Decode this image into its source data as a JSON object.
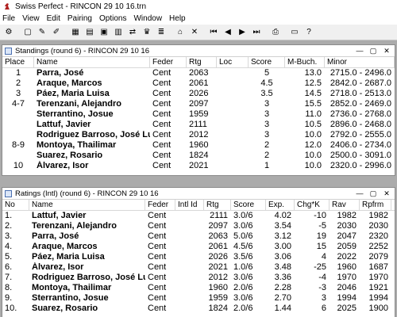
{
  "app": {
    "title": "Swiss Perfect - RINCON 29 10 16.trn"
  },
  "menu": [
    "File",
    "View",
    "Edit",
    "Pairing",
    "Options",
    "Window",
    "Help"
  ],
  "toolbar": [
    {
      "icon": "players-icon",
      "glyph": "⚙"
    },
    {
      "icon": "new-icon",
      "glyph": "▢"
    },
    {
      "icon": "pen-icon",
      "glyph": "✎"
    },
    {
      "icon": "pen-star-icon",
      "glyph": "✐"
    },
    {
      "icon": "table-icon",
      "glyph": "▦"
    },
    {
      "icon": "grid-icon",
      "glyph": "▤"
    },
    {
      "icon": "card-icon",
      "glyph": "▣"
    },
    {
      "icon": "standings-icon",
      "glyph": "▥"
    },
    {
      "icon": "shuffle-icon",
      "glyph": "⇄"
    },
    {
      "icon": "trophy-icon",
      "glyph": "♛"
    },
    {
      "icon": "list-icon",
      "glyph": "≣"
    },
    {
      "icon": "building-icon",
      "glyph": "⌂"
    },
    {
      "icon": "delete-icon",
      "glyph": "✕"
    },
    {
      "icon": "first-icon",
      "glyph": "⏮"
    },
    {
      "icon": "prev-icon",
      "glyph": "◀"
    },
    {
      "icon": "next-icon",
      "glyph": "▶"
    },
    {
      "icon": "last-icon",
      "glyph": "⏭"
    },
    {
      "icon": "print-icon",
      "glyph": "⎙"
    },
    {
      "icon": "preview-icon",
      "glyph": "▭"
    },
    {
      "icon": "help-icon",
      "glyph": "?"
    }
  ],
  "standings": {
    "title": "Standings  (round 6) - RINCON 29 10 16",
    "columns": [
      "Place",
      "Name",
      "Feder",
      "Rtg",
      "Loc",
      "Score",
      "M-Buch.",
      "Minor"
    ],
    "rows": [
      {
        "place": "1",
        "name": "Parra, José",
        "feder": "Cent",
        "rtg": "2063",
        "loc": "",
        "score": "5",
        "mbuch": "13.0",
        "minor": "2715.0 - 2496.0"
      },
      {
        "place": "2",
        "name": "Araque, Marcos",
        "feder": "Cent",
        "rtg": "2061",
        "loc": "",
        "score": "4.5",
        "mbuch": "12.5",
        "minor": "2842.0 - 2687.0"
      },
      {
        "place": "3",
        "name": "Páez, Maria Luisa",
        "feder": "Cent",
        "rtg": "2026",
        "loc": "",
        "score": "3.5",
        "mbuch": "14.5",
        "minor": "2718.0 - 2513.0"
      },
      {
        "place": "4-7",
        "name": "Terenzani, Alejandro",
        "feder": "Cent",
        "rtg": "2097",
        "loc": "",
        "score": "3",
        "mbuch": "15.5",
        "minor": "2852.0 - 2469.0"
      },
      {
        "place": "",
        "name": "Sterrantino, Josue",
        "feder": "Cent",
        "rtg": "1959",
        "loc": "",
        "score": "3",
        "mbuch": "11.0",
        "minor": "2736.0 - 2768.0"
      },
      {
        "place": "",
        "name": "Lattuf, Javier",
        "feder": "Cent",
        "rtg": "2111",
        "loc": "",
        "score": "3",
        "mbuch": "10.5",
        "minor": "2896.0 - 2468.0"
      },
      {
        "place": "",
        "name": "Rodriguez Barroso, José Luis",
        "feder": "Cent",
        "rtg": "2012",
        "loc": "",
        "score": "3",
        "mbuch": "10.0",
        "minor": "2792.0 - 2555.0"
      },
      {
        "place": "8-9",
        "name": "Montoya, Thailimar",
        "feder": "Cent",
        "rtg": "1960",
        "loc": "",
        "score": "2",
        "mbuch": "12.0",
        "minor": "2406.0 - 2734.0"
      },
      {
        "place": "",
        "name": "Suarez, Rosario",
        "feder": "Cent",
        "rtg": "1824",
        "loc": "",
        "score": "2",
        "mbuch": "10.0",
        "minor": "2500.0 - 3091.0"
      },
      {
        "place": "10",
        "name": "Álvarez, Isor",
        "feder": "Cent",
        "rtg": "2021",
        "loc": "",
        "score": "1",
        "mbuch": "10.0",
        "minor": "2320.0 - 2996.0"
      }
    ]
  },
  "ratings": {
    "title": "Ratings (Intl)  (round 6) - RINCON 29 10 16",
    "columns": [
      "No",
      "Name",
      "Feder",
      "Intl Id",
      "Rtg",
      "Score",
      "Exp.",
      "Chg*K",
      "Rav",
      "Rpfrm"
    ],
    "rows": [
      {
        "no": "1.",
        "name": "Lattuf, Javier",
        "feder": "Cent",
        "intl": "",
        "rtg": "2111",
        "score": "3.0/6",
        "exp": "4.02",
        "chg": "-10",
        "rav": "1982",
        "rpfrm": "1982"
      },
      {
        "no": "2.",
        "name": "Terenzani, Alejandro",
        "feder": "Cent",
        "intl": "",
        "rtg": "2097",
        "score": "3.0/6",
        "exp": "3.54",
        "chg": "-5",
        "rav": "2030",
        "rpfrm": "2030"
      },
      {
        "no": "3.",
        "name": "Parra, José",
        "feder": "Cent",
        "intl": "",
        "rtg": "2063",
        "score": "5.0/6",
        "exp": "3.12",
        "chg": "19",
        "rav": "2047",
        "rpfrm": "2320"
      },
      {
        "no": "4.",
        "name": "Araque, Marcos",
        "feder": "Cent",
        "intl": "",
        "rtg": "2061",
        "score": "4.5/6",
        "exp": "3.00",
        "chg": "15",
        "rav": "2059",
        "rpfrm": "2252"
      },
      {
        "no": "5.",
        "name": "Páez, Maria Luisa",
        "feder": "Cent",
        "intl": "",
        "rtg": "2026",
        "score": "3.5/6",
        "exp": "3.06",
        "chg": "4",
        "rav": "2022",
        "rpfrm": "2079"
      },
      {
        "no": "6.",
        "name": "Álvarez, Isor",
        "feder": "Cent",
        "intl": "",
        "rtg": "2021",
        "score": "1.0/6",
        "exp": "3.48",
        "chg": "-25",
        "rav": "1960",
        "rpfrm": "1687"
      },
      {
        "no": "7.",
        "name": "Rodriguez Barroso, José Luis",
        "feder": "Cent",
        "intl": "",
        "rtg": "2012",
        "score": "3.0/6",
        "exp": "3.36",
        "chg": "-4",
        "rav": "1970",
        "rpfrm": "1970"
      },
      {
        "no": "8.",
        "name": "Montoya, Thailimar",
        "feder": "Cent",
        "intl": "",
        "rtg": "1960",
        "score": "2.0/6",
        "exp": "2.28",
        "chg": "-3",
        "rav": "2046",
        "rpfrm": "1921"
      },
      {
        "no": "9.",
        "name": "Sterrantino, Josue",
        "feder": "Cent",
        "intl": "",
        "rtg": "1959",
        "score": "3.0/6",
        "exp": "2.70",
        "chg": "3",
        "rav": "1994",
        "rpfrm": "1994"
      },
      {
        "no": "10.",
        "name": "Suarez, Rosario",
        "feder": "Cent",
        "intl": "",
        "rtg": "1824",
        "score": "2.0/6",
        "exp": "1.44",
        "chg": "6",
        "rav": "2025",
        "rpfrm": "1900"
      }
    ]
  }
}
